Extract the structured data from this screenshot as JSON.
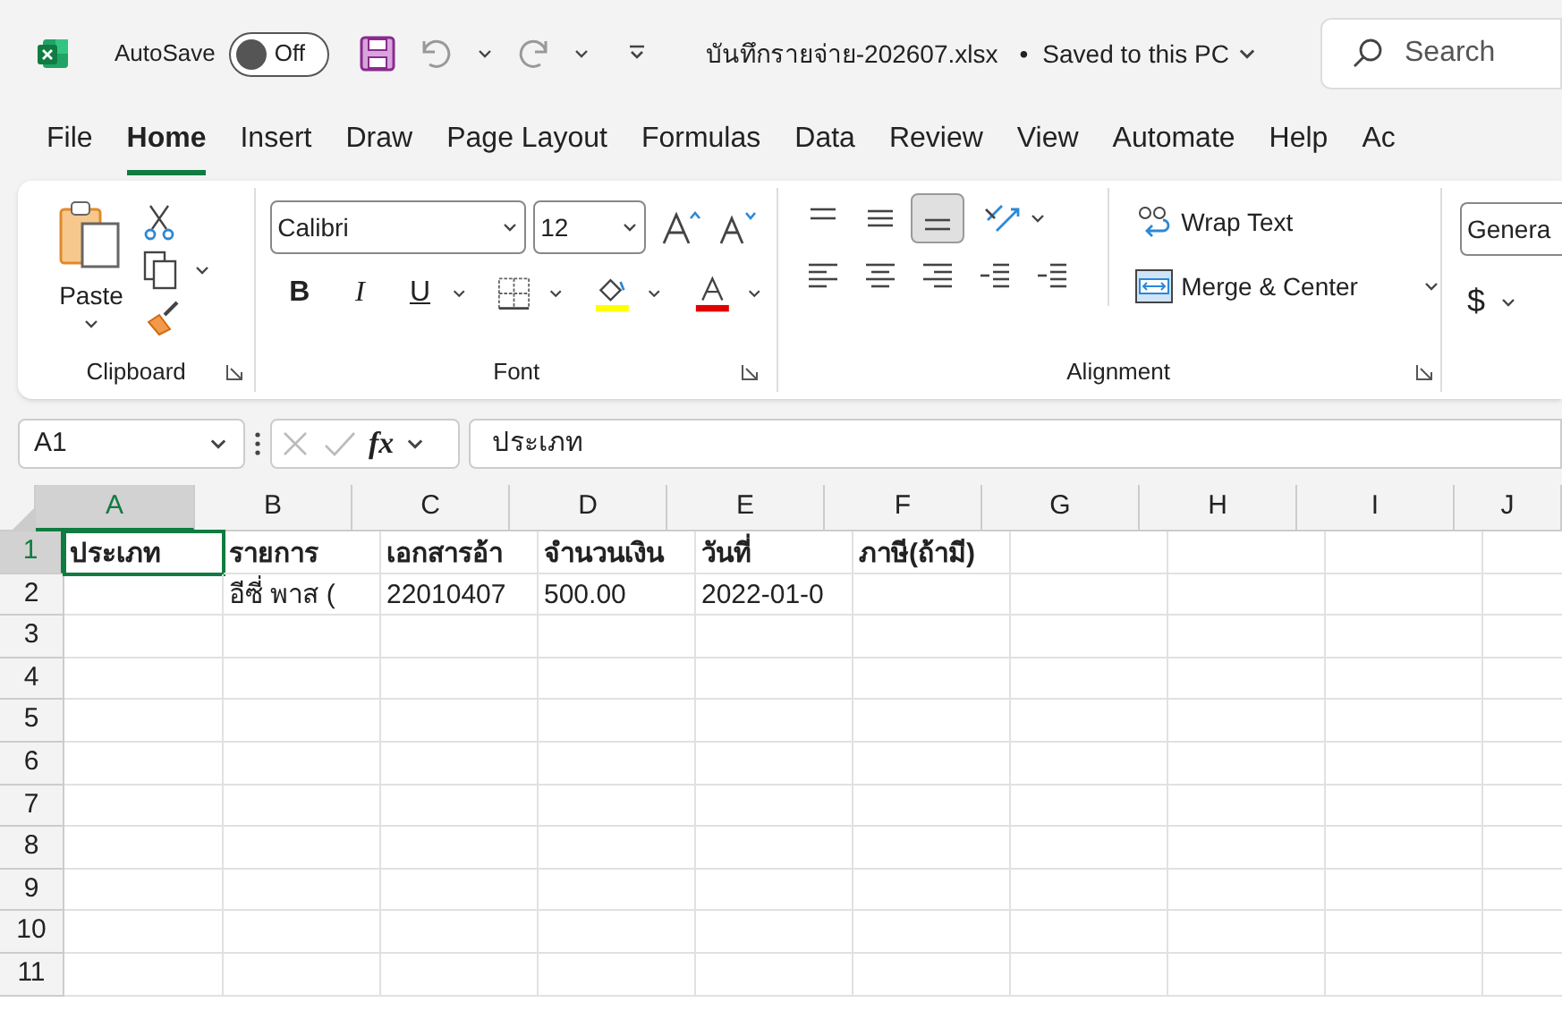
{
  "title_bar": {
    "autosave_label": "AutoSave",
    "autosave": {
      "on": false,
      "label": "Off"
    },
    "file_name": "บันทึกรายจ่าย-202607.xlsx",
    "separator": "•",
    "save_status": "Saved to this PC",
    "search_placeholder": "Search"
  },
  "tabs": [
    {
      "label": "File",
      "selected": false
    },
    {
      "label": "Home",
      "selected": true
    },
    {
      "label": "Insert",
      "selected": false
    },
    {
      "label": "Draw",
      "selected": false
    },
    {
      "label": "Page Layout",
      "selected": false
    },
    {
      "label": "Formulas",
      "selected": false
    },
    {
      "label": "Data",
      "selected": false
    },
    {
      "label": "Review",
      "selected": false
    },
    {
      "label": "View",
      "selected": false
    },
    {
      "label": "Automate",
      "selected": false
    },
    {
      "label": "Help",
      "selected": false
    },
    {
      "label": "Ac",
      "selected": false
    }
  ],
  "ribbon": {
    "paste_label": "Paste",
    "clipboard_group": "Clipboard",
    "font_name": "Calibri",
    "font_size": "12",
    "font_group": "Font",
    "bold_label": "B",
    "italic_label": "I",
    "underline_label": "U",
    "wrap_text": "Wrap Text",
    "merge_center": "Merge & Center",
    "alignment_group": "Alignment",
    "number_format": "Genera",
    "currency_symbol": "$",
    "bottom_align_selected": true
  },
  "formula_bar": {
    "name_box": "A1",
    "fx": "fx",
    "value": "ประเภท"
  },
  "sheet": {
    "columns": [
      {
        "label": "A",
        "selected": true
      },
      {
        "label": "B",
        "selected": false
      },
      {
        "label": "C",
        "selected": false
      },
      {
        "label": "D",
        "selected": false
      },
      {
        "label": "E",
        "selected": false
      },
      {
        "label": "F",
        "selected": false
      },
      {
        "label": "G",
        "selected": false
      },
      {
        "label": "H",
        "selected": false
      },
      {
        "label": "I",
        "selected": false
      },
      {
        "label": "J",
        "selected": false
      }
    ],
    "rows": [
      {
        "label": "1",
        "selected": true,
        "bold": true,
        "cells": [
          "ประเภท",
          "รายการ",
          "เอกสารอ้า",
          "จำนวนเงิน",
          "วันที่",
          "ภาษี(ถ้ามี)",
          "",
          "",
          "",
          ""
        ]
      },
      {
        "label": "2",
        "selected": false,
        "bold": false,
        "cells": [
          "",
          "อีซี่ พาส (",
          "22010407",
          "500.00",
          "2022-01-0",
          "",
          "",
          "",
          "",
          ""
        ]
      },
      {
        "label": "3",
        "selected": false,
        "cells": []
      },
      {
        "label": "4",
        "selected": false,
        "cells": []
      },
      {
        "label": "5",
        "selected": false,
        "cells": []
      },
      {
        "label": "6",
        "selected": false,
        "cells": []
      },
      {
        "label": "7",
        "selected": false,
        "cells": []
      },
      {
        "label": "8",
        "selected": false,
        "cells": []
      },
      {
        "label": "9",
        "selected": false,
        "cells": []
      },
      {
        "label": "10",
        "selected": false,
        "cells": []
      },
      {
        "label": "11",
        "selected": false,
        "cells": []
      }
    ]
  }
}
